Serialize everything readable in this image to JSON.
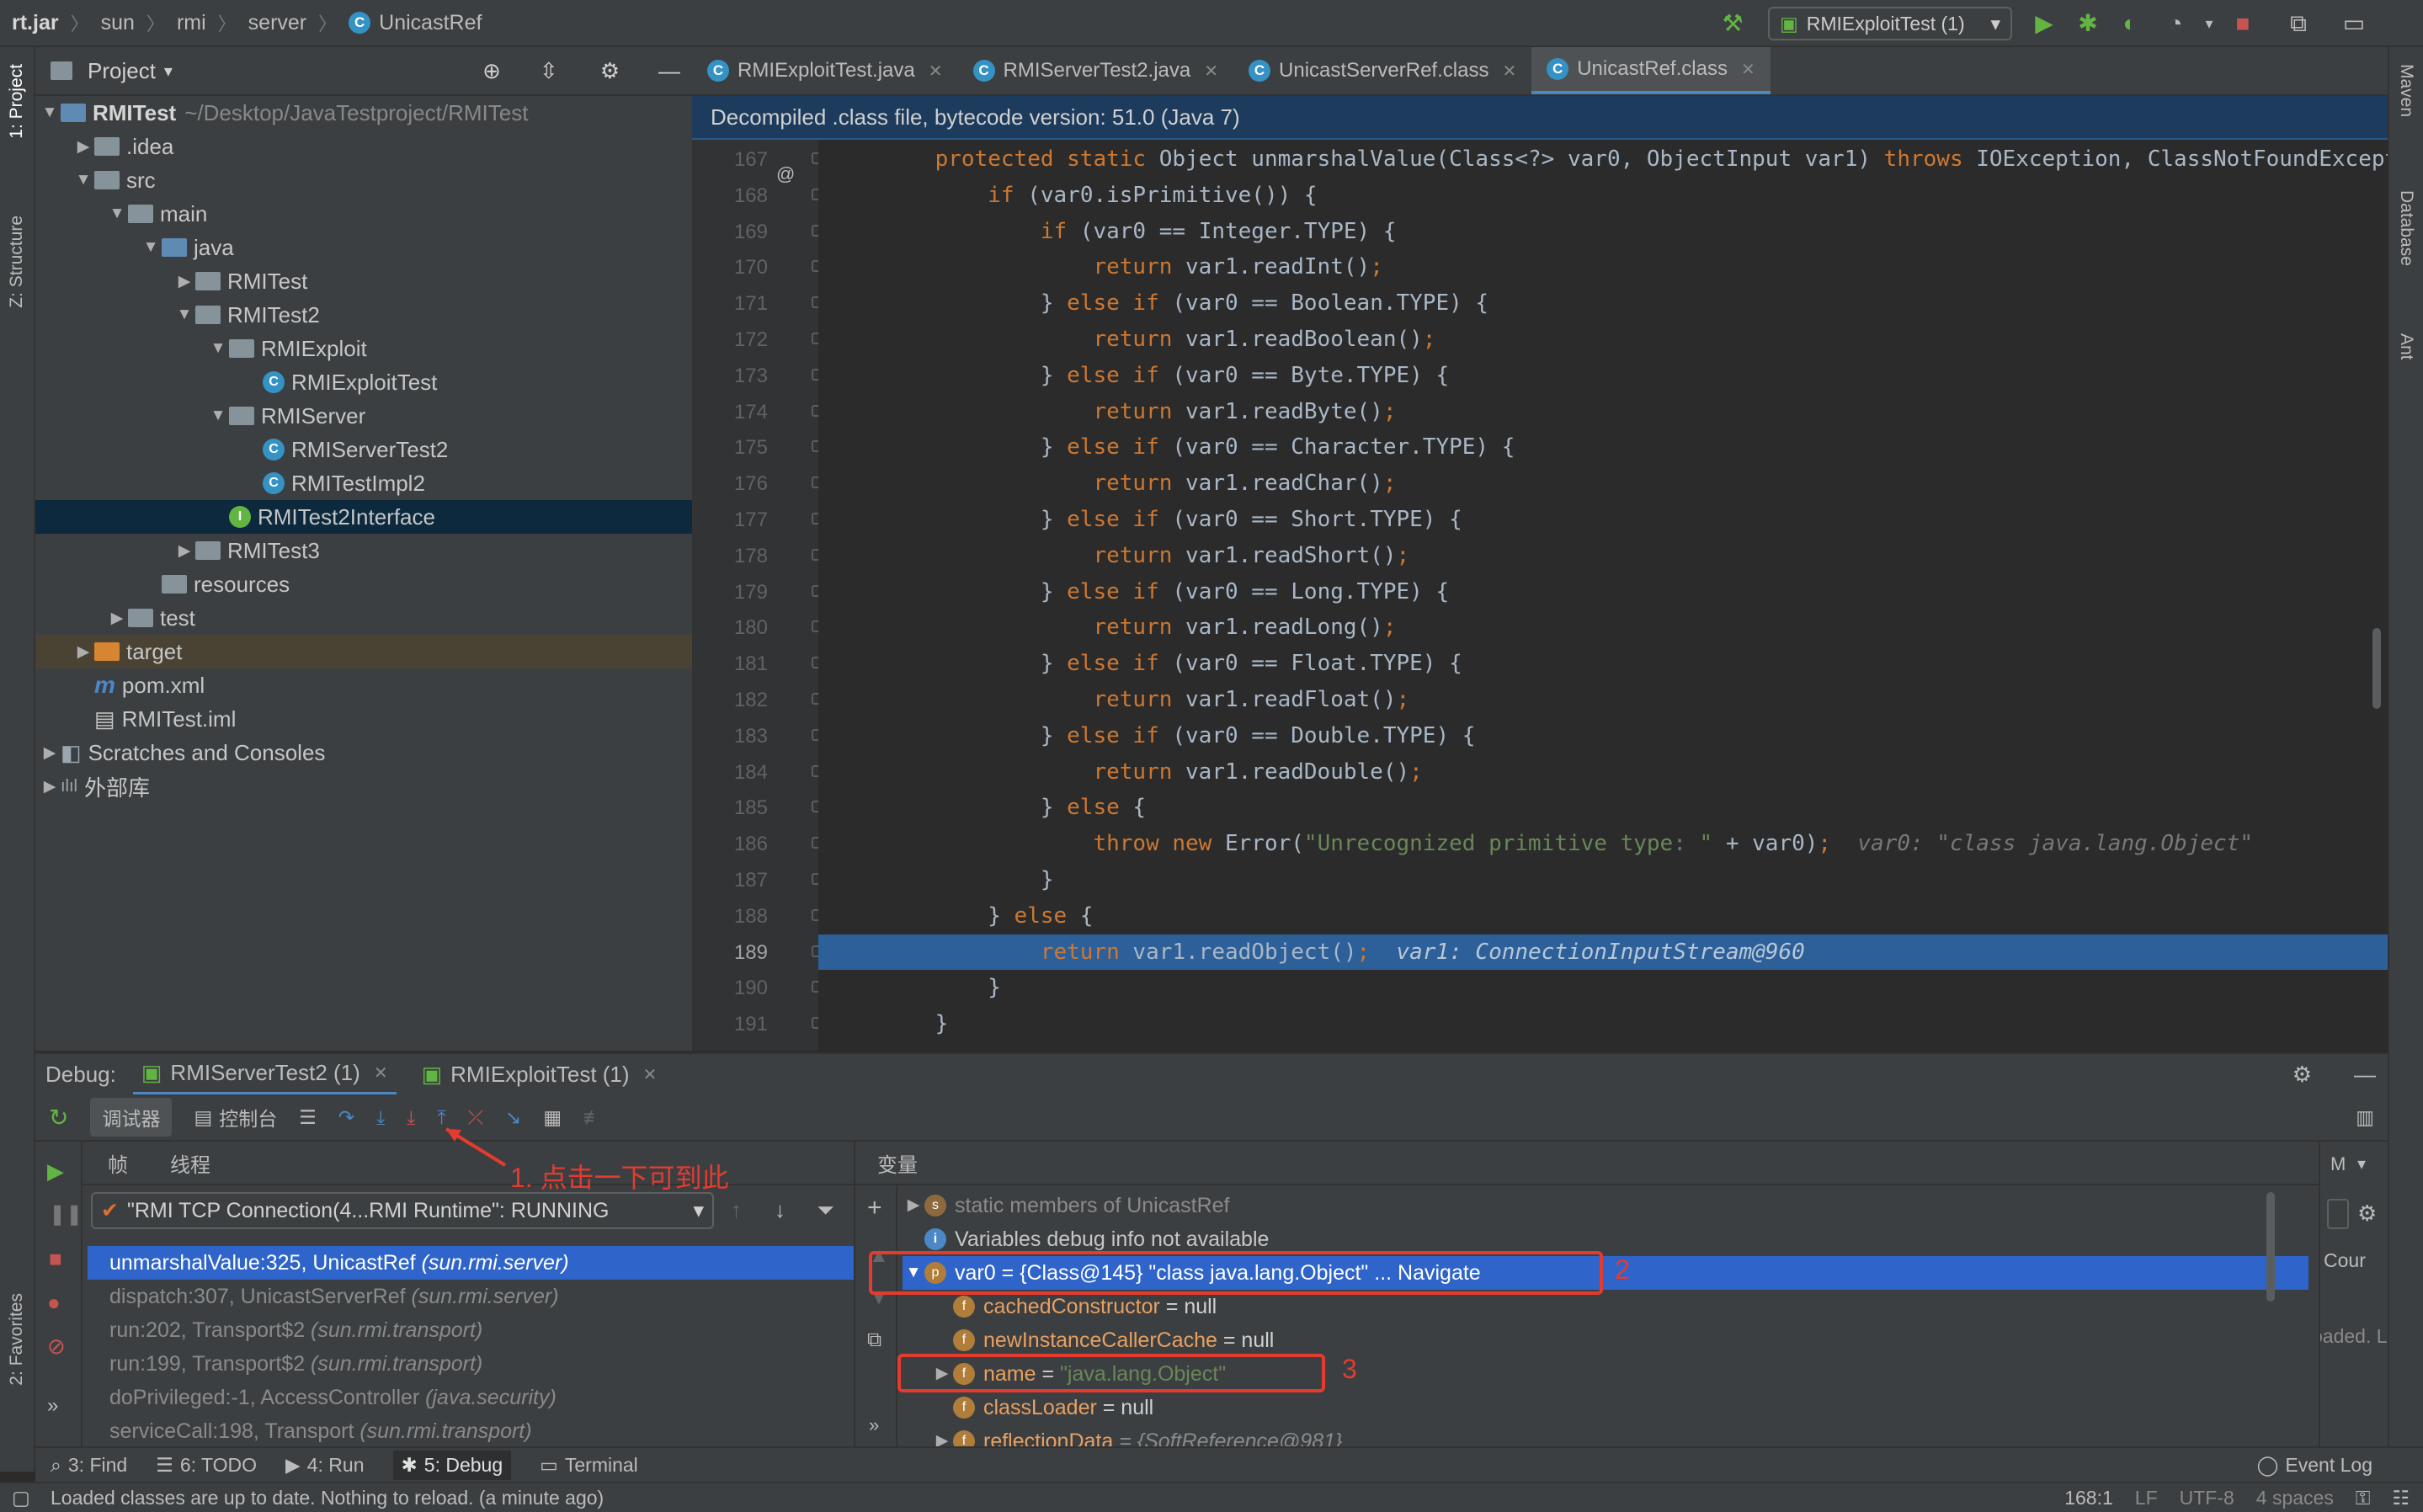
{
  "breadcrumb": [
    "rt.jar",
    "sun",
    "rmi",
    "server",
    "UnicastRef"
  ],
  "run_config": "RMIExploitTest (1)",
  "left_strip": [
    "1: Project",
    "Z: Structure",
    "2: Favorites"
  ],
  "right_strip": [
    "Maven",
    "Database",
    "Ant"
  ],
  "project": {
    "title": "Project",
    "items": [
      {
        "label": "RMITest",
        "extra": "~/Desktop/JavaTestproject/RMITest",
        "indent": 0,
        "arrow": "down",
        "icon": "blue"
      },
      {
        "label": ".idea",
        "indent": 1,
        "arrow": "right",
        "icon": "folder"
      },
      {
        "label": "src",
        "indent": 1,
        "arrow": "down",
        "icon": "folder"
      },
      {
        "label": "main",
        "indent": 2,
        "arrow": "down",
        "icon": "folder"
      },
      {
        "label": "java",
        "indent": 3,
        "arrow": "down",
        "icon": "blue"
      },
      {
        "label": "RMITest",
        "indent": 4,
        "arrow": "right",
        "icon": "folder"
      },
      {
        "label": "RMITest2",
        "indent": 4,
        "arrow": "down",
        "icon": "folder"
      },
      {
        "label": "RMIExploit",
        "indent": 5,
        "arrow": "down",
        "icon": "folder"
      },
      {
        "label": "RMIExploitTest",
        "indent": 6,
        "arrow": "",
        "icon": "class"
      },
      {
        "label": "RMIServer",
        "indent": 5,
        "arrow": "down",
        "icon": "folder"
      },
      {
        "label": "RMIServerTest2",
        "indent": 6,
        "arrow": "",
        "icon": "class"
      },
      {
        "label": "RMITestImpl2",
        "indent": 6,
        "arrow": "",
        "icon": "class"
      },
      {
        "label": "RMITest2Interface",
        "indent": 5,
        "arrow": "",
        "icon": "iface",
        "selected": true
      },
      {
        "label": "RMITest3",
        "indent": 4,
        "arrow": "right",
        "icon": "folder"
      },
      {
        "label": "resources",
        "indent": 3,
        "arrow": "",
        "icon": "res"
      },
      {
        "label": "test",
        "indent": 2,
        "arrow": "right",
        "icon": "folder"
      },
      {
        "label": "target",
        "indent": 1,
        "arrow": "right",
        "icon": "orange",
        "target": true
      },
      {
        "label": "pom.xml",
        "indent": 1,
        "arrow": "",
        "icon": "maven"
      },
      {
        "label": "RMITest.iml",
        "indent": 1,
        "arrow": "",
        "icon": "file"
      },
      {
        "label": "Scratches and Consoles",
        "indent": 0,
        "arrow": "right",
        "icon": "scratch"
      },
      {
        "label": "外部库",
        "indent": 0,
        "arrow": "right",
        "icon": "lib"
      }
    ]
  },
  "tabs": [
    "RMIExploitTest.java",
    "RMIServerTest2.java",
    "UnicastServerRef.class",
    "UnicastRef.class"
  ],
  "banner": "Decompiled .class file, bytecode version: 51.0 (Java 7)",
  "code": {
    "lines": [
      {
        "n": "167",
        "html": "    <span class=\"kw\">protected static</span> Object unmarshalValue(Class&lt;?&gt; var0, ObjectInput var1) <span class=\"kw\">throws</span> IOException, ClassNotFoundExcepti"
      },
      {
        "n": "168",
        "html": "        <span class=\"kw\">if</span> (var0.isPrimitive()) {"
      },
      {
        "n": "169",
        "html": "            <span class=\"kw\">if</span> (var0 == Integer.TYPE) {"
      },
      {
        "n": "170",
        "html": "                <span class=\"kw\">return</span> var1.readInt()<span class=\"kw\">;</span>"
      },
      {
        "n": "171",
        "html": "            } <span class=\"kw\">else if</span> (var0 == Boolean.TYPE) {"
      },
      {
        "n": "172",
        "html": "                <span class=\"kw\">return</span> var1.readBoolean()<span class=\"kw\">;</span>"
      },
      {
        "n": "173",
        "html": "            } <span class=\"kw\">else if</span> (var0 == Byte.TYPE) {"
      },
      {
        "n": "174",
        "html": "                <span class=\"kw\">return</span> var1.readByte()<span class=\"kw\">;</span>"
      },
      {
        "n": "175",
        "html": "            } <span class=\"kw\">else if</span> (var0 == Character.TYPE) {"
      },
      {
        "n": "176",
        "html": "                <span class=\"kw\">return</span> var1.readChar()<span class=\"kw\">;</span>"
      },
      {
        "n": "177",
        "html": "            } <span class=\"kw\">else if</span> (var0 == Short.TYPE) {"
      },
      {
        "n": "178",
        "html": "                <span class=\"kw\">return</span> var1.readShort()<span class=\"kw\">;</span>"
      },
      {
        "n": "179",
        "html": "            } <span class=\"kw\">else if</span> (var0 == Long.TYPE) {"
      },
      {
        "n": "180",
        "html": "                <span class=\"kw\">return</span> var1.readLong()<span class=\"kw\">;</span>"
      },
      {
        "n": "181",
        "html": "            } <span class=\"kw\">else if</span> (var0 == Float.TYPE) {"
      },
      {
        "n": "182",
        "html": "                <span class=\"kw\">return</span> var1.readFloat()<span class=\"kw\">;</span>"
      },
      {
        "n": "183",
        "html": "            } <span class=\"kw\">else if</span> (var0 == Double.TYPE) {"
      },
      {
        "n": "184",
        "html": "                <span class=\"kw\">return</span> var1.readDouble()<span class=\"kw\">;</span>"
      },
      {
        "n": "185",
        "html": "            } <span class=\"kw\">else</span> {"
      },
      {
        "n": "186",
        "html": "                <span class=\"kw\">throw new</span> Error(<span class=\"str\">\"Unrecognized primitive type: \"</span> + var0)<span class=\"kw\">;</span>  <span class=\"hint\">var0: \"class java.lang.Object\"</span>"
      },
      {
        "n": "187",
        "html": "            }"
      },
      {
        "n": "188",
        "html": "        } <span class=\"kw\">else</span> {"
      },
      {
        "n": "189",
        "html": "            <span class=\"kw\">return</span> var1.readObject()<span class=\"kw\">;</span>  <span class=\"hintw\">var1: ConnectionInputStream@960</span>",
        "hl": true
      },
      {
        "n": "190",
        "html": "        }"
      },
      {
        "n": "191",
        "html": "    }"
      }
    ]
  },
  "debug": {
    "label": "Debug:",
    "tabs": [
      "RMIServerTest2 (1)",
      "RMIExploitTest (1)"
    ],
    "toolbar": {
      "debugger": "调试器",
      "console": "控制台"
    },
    "frames_tab": "帧",
    "threads_tab": "线程",
    "vars_title": "变量",
    "thread": "\"RMI TCP Connection(4...RMI Runtime\": RUNNING",
    "frames": [
      {
        "m": "unmarshalValue:325, UnicastRef ",
        "p": "(sun.rmi.server)"
      },
      {
        "m": "dispatch:307, UnicastServerRef ",
        "p": "(sun.rmi.server)"
      },
      {
        "m": "run:202, Transport$2 ",
        "p": "(sun.rmi.transport)"
      },
      {
        "m": "run:199, Transport$2 ",
        "p": "(sun.rmi.transport)"
      },
      {
        "m": "doPrivileged:-1, AccessController ",
        "p": "(java.security)"
      },
      {
        "m": "serviceCall:198, Transport ",
        "p": "(sun.rmi.transport)"
      }
    ],
    "vars": {
      "static": "static members of UnicastRef",
      "info": "Variables debug info not available",
      "var0": "var0 = {Class@145} \"class java.lang.Object\" ... Navigate",
      "children": [
        {
          "name": "cachedConstructor",
          "val": " = null"
        },
        {
          "name": "newInstanceCallerCache",
          "val": " = null"
        },
        {
          "name": "name",
          "val": " = ",
          "str": "\"java.lang.Object\""
        },
        {
          "name": "classLoader",
          "val": " = null"
        },
        {
          "name": "reflectionData",
          "val": " = {SoftReference@981}"
        }
      ]
    },
    "annotations": {
      "a1": "1. 点击一下可到此",
      "a2": "2",
      "a3": "3"
    },
    "right_partial": [
      "Cour",
      "oaded. L",
      "M"
    ]
  },
  "bottom_tabs": [
    "3: Find",
    "6: TODO",
    "4: Run",
    "5: Debug",
    "Terminal"
  ],
  "event_log": "Event Log",
  "status": {
    "msg": "Loaded classes are up to date. Nothing to reload. (a minute ago)",
    "pos": "168:1",
    "lf": "LF",
    "enc": "UTF-8",
    "indent": "4 spaces"
  }
}
